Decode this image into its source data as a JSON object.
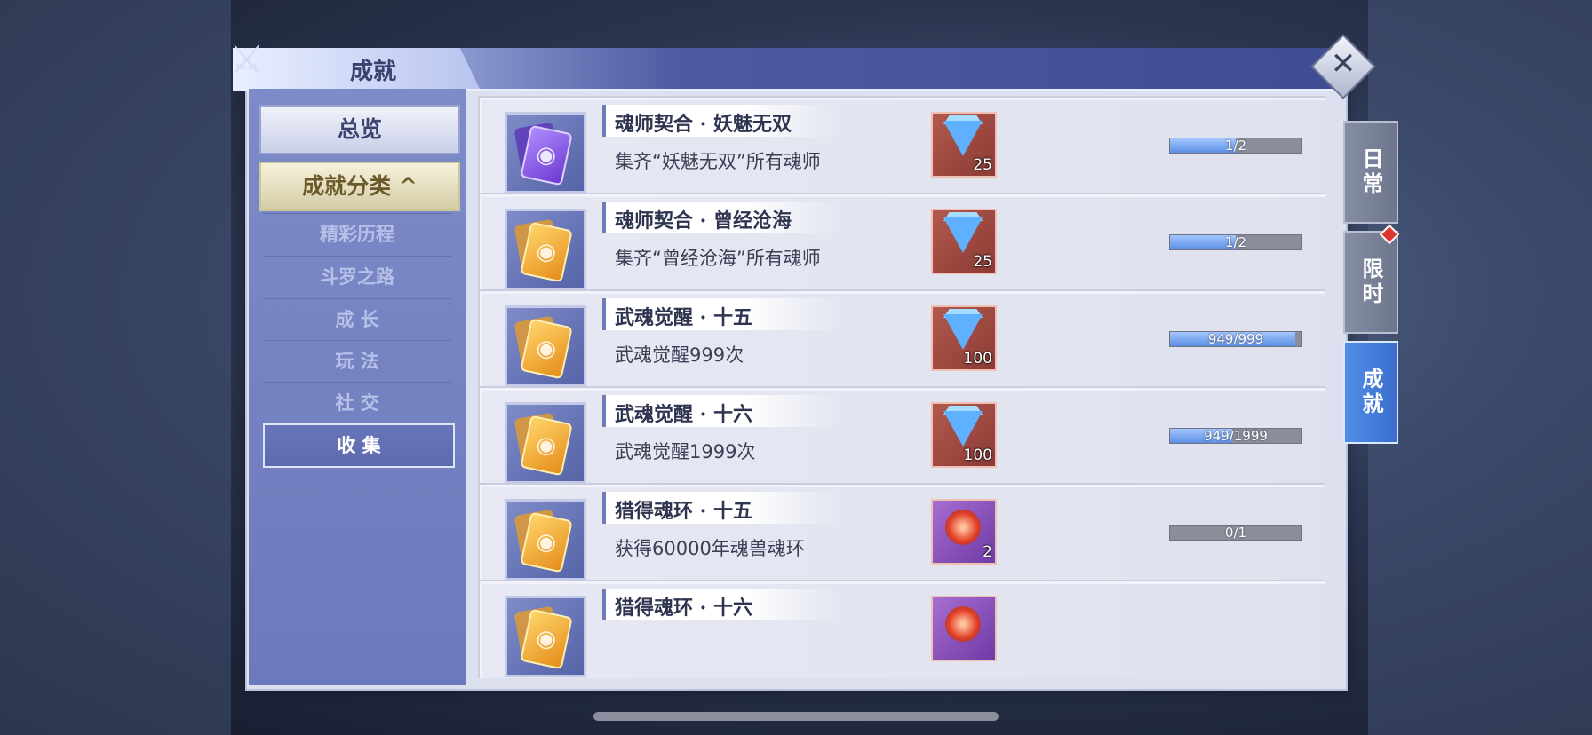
{
  "window": {
    "title": "成就",
    "close_label": "✕"
  },
  "sidebar": {
    "overview_label": "总览",
    "category_label": "成就分类 ^",
    "items": [
      {
        "label": "精彩历程",
        "active": false
      },
      {
        "label": "斗罗之路",
        "active": false
      },
      {
        "label": "成 长",
        "active": false
      },
      {
        "label": "玩 法",
        "active": false
      },
      {
        "label": "社 交",
        "active": false
      },
      {
        "label": "收 集",
        "active": true
      }
    ]
  },
  "side_tabs": [
    {
      "label": "日常",
      "active": false
    },
    {
      "label": "限时",
      "active": false,
      "notification": true
    },
    {
      "label": "成就",
      "active": true
    }
  ],
  "achievements": [
    {
      "title": "魂师契合 · 妖魅无双",
      "desc": "集齐“妖魅无双”所有魂师",
      "icon": "purple-card-icon",
      "reward_icon": "diamond-icon",
      "reward_count": "25",
      "progress_text": "1/2",
      "progress": 0.5
    },
    {
      "title": "魂师契合 · 曾经沧海",
      "desc": "集齐“曾经沧海”所有魂师",
      "icon": "gold-card-icon",
      "reward_icon": "diamond-icon",
      "reward_count": "25",
      "progress_text": "1/2",
      "progress": 0.5
    },
    {
      "title": "武魂觉醒 · 十五",
      "desc": "武魂觉醒999次",
      "icon": "gold-card-icon",
      "reward_icon": "diamond-icon",
      "reward_count": "100",
      "progress_text": "949/999",
      "progress": 0.95
    },
    {
      "title": "武魂觉醒 · 十六",
      "desc": "武魂觉醒1999次",
      "icon": "gold-card-icon",
      "reward_icon": "diamond-icon",
      "reward_count": "100",
      "progress_text": "949/1999",
      "progress": 0.475
    },
    {
      "title": "猎得魂环 · 十五",
      "desc": "获得60000年魂兽魂环",
      "icon": "gold-card-icon",
      "reward_icon": "soul-ring-icon",
      "reward_count": "2",
      "progress_text": "0/1",
      "progress": 0
    },
    {
      "title": "猎得魂环 · 十六",
      "desc": "",
      "icon": "gold-card-icon",
      "reward_icon": "soul-ring-icon",
      "reward_count": "",
      "progress_text": "",
      "progress": 0
    }
  ],
  "colors": {
    "accent_blue": "#5d8fe3",
    "panel_bg": "#dde0ee",
    "sidebar_bg": "#7d8bc8",
    "active_tab": "#3a6ccc",
    "notification": "#e0352c"
  }
}
